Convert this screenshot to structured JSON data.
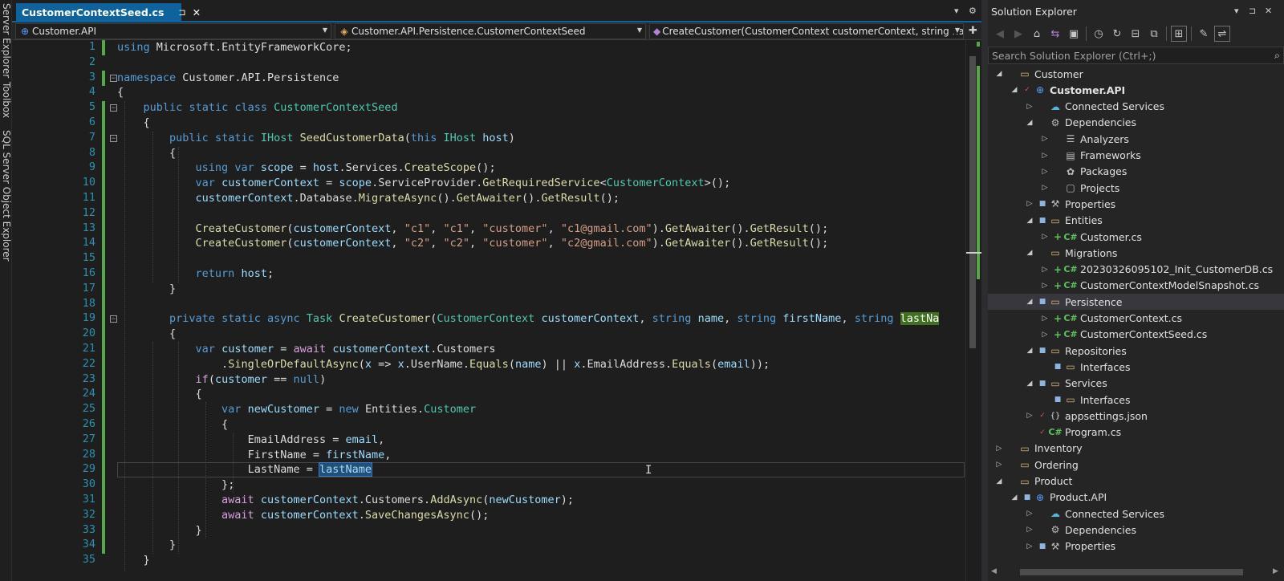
{
  "left_strip": {
    "tool_windows": [
      "Server Explorer",
      "Toolbox",
      "SQL Server Object Explorer"
    ]
  },
  "editor": {
    "tab": {
      "title": "CustomerContextSeed.cs",
      "pin": "⊐",
      "close": "✕"
    },
    "tabbar_controls": {
      "dropdown": "▾",
      "settings": "⚙"
    },
    "nav": {
      "project": "Customer.API",
      "class": "Customer.API.Persistence.CustomerContextSeed",
      "member": "CreateCustomer(CustomerContext customerContext, string nam"
    },
    "current_line": 29,
    "lines": [
      {
        "n": 1,
        "code": "using Microsoft.EntityFrameworkCore;"
      },
      {
        "n": 2,
        "code": ""
      },
      {
        "n": 3,
        "code": "namespace Customer.API.Persistence"
      },
      {
        "n": 4,
        "code": "{"
      },
      {
        "n": 5,
        "code": "    public static class CustomerContextSeed"
      },
      {
        "n": 6,
        "code": "    {"
      },
      {
        "n": 7,
        "code": "        public static IHost SeedCustomerData(this IHost host)"
      },
      {
        "n": 8,
        "code": "        {"
      },
      {
        "n": 9,
        "code": "            using var scope = host.Services.CreateScope();"
      },
      {
        "n": 10,
        "code": "            var customerContext = scope.ServiceProvider.GetRequiredService<CustomerContext>();"
      },
      {
        "n": 11,
        "code": "            customerContext.Database.MigrateAsync().GetAwaiter().GetResult();"
      },
      {
        "n": 12,
        "code": ""
      },
      {
        "n": 13,
        "code": "            CreateCustomer(customerContext, \"c1\", \"c1\", \"customer\", \"c1@gmail.com\").GetAwaiter().GetResult();"
      },
      {
        "n": 14,
        "code": "            CreateCustomer(customerContext, \"c2\", \"c2\", \"customer\", \"c2@gmail.com\").GetAwaiter().GetResult();"
      },
      {
        "n": 15,
        "code": ""
      },
      {
        "n": 16,
        "code": "            return host;"
      },
      {
        "n": 17,
        "code": "        }"
      },
      {
        "n": 18,
        "code": ""
      },
      {
        "n": 19,
        "code": "        private static async Task CreateCustomer(CustomerContext customerContext, string name, string firstName, string lastNa"
      },
      {
        "n": 20,
        "code": "        {"
      },
      {
        "n": 21,
        "code": "            var customer = await customerContext.Customers"
      },
      {
        "n": 22,
        "code": "                .SingleOrDefaultAsync(x => x.UserName.Equals(name) || x.EmailAddress.Equals(email));"
      },
      {
        "n": 23,
        "code": "            if(customer == null)"
      },
      {
        "n": 24,
        "code": "            {"
      },
      {
        "n": 25,
        "code": "                var newCustomer = new Entities.Customer"
      },
      {
        "n": 26,
        "code": "                {"
      },
      {
        "n": 27,
        "code": "                    EmailAddress = email,"
      },
      {
        "n": 28,
        "code": "                    FirstName = firstName,"
      },
      {
        "n": 29,
        "code": "                    LastName = lastName"
      },
      {
        "n": 30,
        "code": "                };"
      },
      {
        "n": 31,
        "code": "                await customerContext.Customers.AddAsync(newCustomer);"
      },
      {
        "n": 32,
        "code": "                await customerContext.SaveChangesAsync();"
      },
      {
        "n": 33,
        "code": "            }"
      },
      {
        "n": 34,
        "code": "        }"
      },
      {
        "n": 35,
        "code": "    }"
      }
    ]
  },
  "solution_explorer": {
    "title": "Solution Explorer",
    "title_controls": {
      "pin": "▾",
      "dock": "⊐",
      "close": "✕"
    },
    "toolbar_icons": [
      "back-icon",
      "forward-icon",
      "home-icon",
      "switch-views-icon",
      "pending-changes-icon",
      "history-icon",
      "refresh-icon",
      "collapse-all-icon",
      "show-all-files-icon",
      "preview-icon",
      "properties-icon",
      "sync-icon"
    ],
    "search_placeholder": "Search Solution Explorer (Ctrl+;)",
    "search_icon": "⌕",
    "items": [
      {
        "label": "Customer",
        "depth": 1,
        "exp": "▲",
        "icon": "folder",
        "deco": ""
      },
      {
        "label": "Customer.API",
        "depth": 2,
        "exp": "▲",
        "icon": "proj",
        "deco": "check",
        "bold": true
      },
      {
        "label": "Connected Services",
        "depth": 3,
        "exp": "▷",
        "icon": "svc",
        "deco": ""
      },
      {
        "label": "Dependencies",
        "depth": 3,
        "exp": "▲",
        "icon": "dep",
        "deco": ""
      },
      {
        "label": "Analyzers",
        "depth": 4,
        "exp": "▷",
        "icon": "analyzer",
        "deco": ""
      },
      {
        "label": "Frameworks",
        "depth": 4,
        "exp": "▷",
        "icon": "framework",
        "deco": ""
      },
      {
        "label": "Packages",
        "depth": 4,
        "exp": "▷",
        "icon": "package",
        "deco": ""
      },
      {
        "label": "Projects",
        "depth": 4,
        "exp": "▷",
        "icon": "projects",
        "deco": ""
      },
      {
        "label": "Properties",
        "depth": 3,
        "exp": "▷",
        "icon": "props",
        "deco": "lock"
      },
      {
        "label": "Entities",
        "depth": 3,
        "exp": "▲",
        "icon": "folder",
        "deco": "lock"
      },
      {
        "label": "Customer.cs",
        "depth": 4,
        "exp": "▷",
        "icon": "cs",
        "deco": "plus"
      },
      {
        "label": "Migrations",
        "depth": 3,
        "exp": "▲",
        "icon": "folder",
        "deco": ""
      },
      {
        "label": "20230326095102_Init_CustomerDB.cs",
        "depth": 4,
        "exp": "▷",
        "icon": "cs",
        "deco": "plus"
      },
      {
        "label": "CustomerContextModelSnapshot.cs",
        "depth": 4,
        "exp": "▷",
        "icon": "cs",
        "deco": "plus"
      },
      {
        "label": "Persistence",
        "depth": 3,
        "exp": "▲",
        "icon": "folder",
        "deco": "lock",
        "selected": true
      },
      {
        "label": "CustomerContext.cs",
        "depth": 4,
        "exp": "▷",
        "icon": "cs",
        "deco": "plus"
      },
      {
        "label": "CustomerContextSeed.cs",
        "depth": 4,
        "exp": "▷",
        "icon": "cs",
        "deco": "plus"
      },
      {
        "label": "Repositories",
        "depth": 3,
        "exp": "▲",
        "icon": "folder",
        "deco": "lock"
      },
      {
        "label": "Interfaces",
        "depth": 4,
        "exp": "",
        "icon": "folder",
        "deco": "lock"
      },
      {
        "label": "Services",
        "depth": 3,
        "exp": "▲",
        "icon": "folder",
        "deco": "lock"
      },
      {
        "label": "Interfaces",
        "depth": 4,
        "exp": "",
        "icon": "folder",
        "deco": "lock"
      },
      {
        "label": "appsettings.json",
        "depth": 3,
        "exp": "▷",
        "icon": "json",
        "deco": "check"
      },
      {
        "label": "Program.cs",
        "depth": 3,
        "exp": "",
        "icon": "cs",
        "deco": "check"
      },
      {
        "label": "Inventory",
        "depth": 1,
        "exp": "▷",
        "icon": "folder",
        "deco": ""
      },
      {
        "label": "Ordering",
        "depth": 1,
        "exp": "▷",
        "icon": "folder",
        "deco": ""
      },
      {
        "label": "Product",
        "depth": 1,
        "exp": "▲",
        "icon": "folder",
        "deco": ""
      },
      {
        "label": "Product.API",
        "depth": 2,
        "exp": "▲",
        "icon": "proj",
        "deco": "lock"
      },
      {
        "label": "Connected Services",
        "depth": 3,
        "exp": "▷",
        "icon": "svc",
        "deco": ""
      },
      {
        "label": "Dependencies",
        "depth": 3,
        "exp": "▷",
        "icon": "dep",
        "deco": ""
      },
      {
        "label": "Properties",
        "depth": 3,
        "exp": "▷",
        "icon": "props",
        "deco": "lock"
      }
    ]
  }
}
